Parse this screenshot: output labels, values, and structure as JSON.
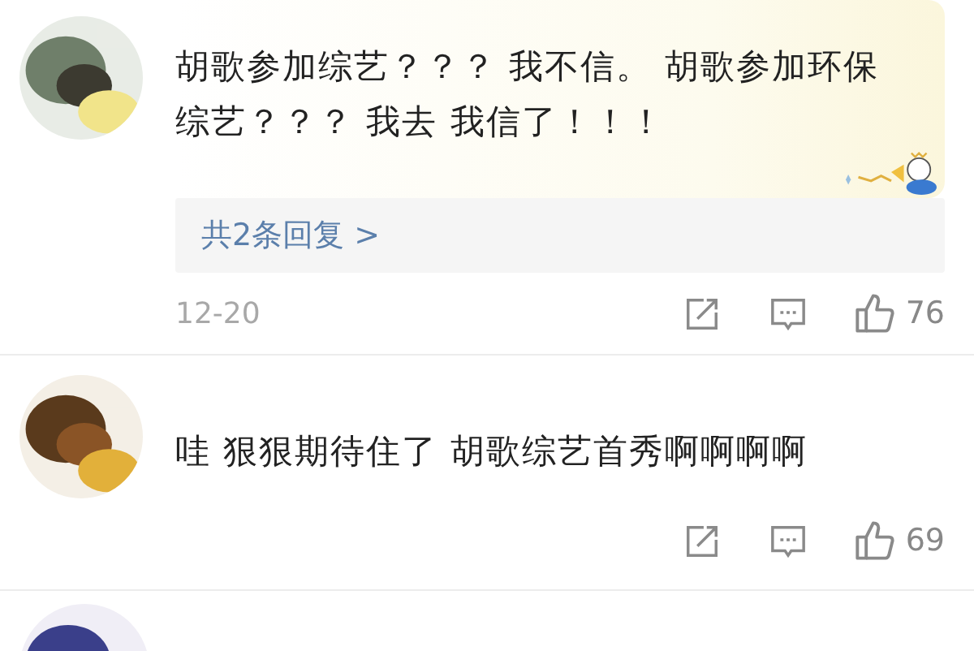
{
  "comments": [
    {
      "kind": "decorated",
      "text": "胡歌参加综艺？？？ 我不信。 胡歌参加环保综艺？？？ 我去 我信了！！！",
      "replies": "共2条回复 >",
      "date": "12-20",
      "likes": "76"
    },
    {
      "kind": "plain",
      "text": "哇 狠狠期待住了 胡歌综艺首秀啊啊啊啊",
      "likes": "69"
    },
    {
      "kind": "plain"
    }
  ]
}
